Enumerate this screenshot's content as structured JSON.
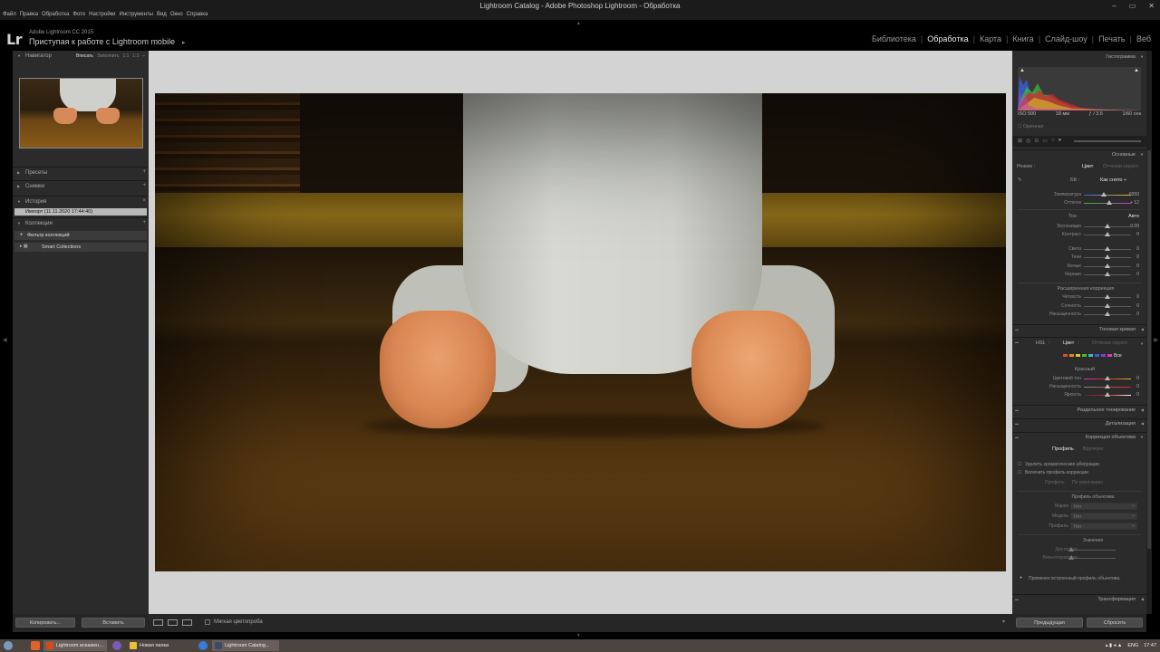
{
  "window": {
    "title": "Lightroom Catalog - Adobe Photoshop Lightroom - Обработка",
    "menu": [
      "Файл",
      "Правка",
      "Обработка",
      "Фото",
      "Настройки",
      "Инструменты",
      "Вид",
      "Окно",
      "Справка"
    ],
    "controls": [
      "–",
      "▭",
      "✕"
    ]
  },
  "identity": {
    "logo": "Lr",
    "subtitle": "Adobe Lightroom CC 2015",
    "main": "Приступая к работе с Lightroom mobile",
    "arrow": "▸"
  },
  "modules": [
    {
      "label": "Библиотека",
      "active": false
    },
    {
      "label": "Обработка",
      "active": true
    },
    {
      "label": "Карта",
      "active": false
    },
    {
      "label": "Книга",
      "active": false
    },
    {
      "label": "Слайд-шоу",
      "active": false
    },
    {
      "label": "Печать",
      "active": false
    },
    {
      "label": "Веб",
      "active": false
    }
  ],
  "left": {
    "navigator": {
      "label": "Навигатор",
      "zooms": [
        "Вписать",
        "Заполнить",
        "1:1",
        "1:3"
      ],
      "active_zoom": 0,
      "arrow": "÷"
    },
    "presets": {
      "label": "Пресеты",
      "plus": "+"
    },
    "snapshots": {
      "label": "Снимки",
      "plus": "+"
    },
    "history": {
      "label": "История",
      "close": "×",
      "item": "Импорт (11.11.2020 17:44:40)"
    },
    "collections": {
      "label": "Коллекции",
      "plus": "+",
      "filter": "Фильтр коллекций",
      "smart": "Smart Collections"
    },
    "buttons": {
      "copy": "Копировать...",
      "paste": "Вставить"
    }
  },
  "toolbar": {
    "softproof": "Мягкая цветопроба"
  },
  "right": {
    "histogram": {
      "label": "Гистограмма",
      "iso": "ISO 500",
      "focal": "18 мм",
      "aperture": "ƒ / 3.5",
      "shutter": "1/60 сек",
      "original": "Оригинал",
      "colors": {
        "red": "#d8262a",
        "green": "#35b83a",
        "blue": "#3a5ee0",
        "yellow": "#d8c22a",
        "magenta": "#c43ac4",
        "cyan": "#3ac4c4"
      }
    },
    "basic": {
      "label": "Основные",
      "treatment_label": "Режим :",
      "treatment_color": "Цвет",
      "treatment_bw": "Оттенки серого",
      "wb_label": "ББ :",
      "wb_value": "Как снято",
      "wb_arrow": "÷",
      "temp": {
        "label": "Температура",
        "value": "6050",
        "pos": 0.42
      },
      "tint": {
        "label": "Оттенок",
        "value": "+ 12",
        "pos": 0.53
      },
      "tone_label": "Тон",
      "tone_auto": "Авто",
      "exposure": {
        "label": "Экспозиция",
        "value": "0.00",
        "pos": 0.5
      },
      "contrast": {
        "label": "Контраст",
        "value": "0",
        "pos": 0.5
      },
      "highlights": {
        "label": "Света",
        "value": "0",
        "pos": 0.5
      },
      "shadows": {
        "label": "Тени",
        "value": "0",
        "pos": 0.5
      },
      "whites": {
        "label": "Белые",
        "value": "0",
        "pos": 0.5
      },
      "blacks": {
        "label": "Черные",
        "value": "0",
        "pos": 0.5
      },
      "presence_label": "Расширенная коррекция",
      "clarity": {
        "label": "Четкость",
        "value": "0",
        "pos": 0.5
      },
      "vibrance": {
        "label": "Сочность",
        "value": "0",
        "pos": 0.5
      },
      "saturation": {
        "label": "Насыщенность",
        "value": "0",
        "pos": 0.5
      }
    },
    "tonecurve": {
      "label": "Тоновая кривая"
    },
    "hsl": {
      "tab_hsl": "HSL",
      "tab_color": "Цвет",
      "tab_bw": "Оттенки серого",
      "all": "Все",
      "swatches": [
        "#d84a3a",
        "#d88a2a",
        "#d8c82a",
        "#4ab83a",
        "#3ab8b8",
        "#3a5ed8",
        "#8a3ad8",
        "#d83ab8"
      ],
      "red_label": "Красный",
      "hue": {
        "label": "Цветовой тон",
        "value": "0",
        "pos": 0.5
      },
      "sat": {
        "label": "Насыщенность",
        "value": "0",
        "pos": 0.5
      },
      "lum": {
        "label": "Яркость",
        "value": "0",
        "pos": 0.5
      }
    },
    "split": {
      "label": "Раздельное тонирование"
    },
    "detail": {
      "label": "Детализация"
    },
    "lens": {
      "label": "Коррекция объектива",
      "tab_profile": "Профиль",
      "tab_manual": "Вручную",
      "remove_ca": "Удалить хроматические аберрации",
      "enable_profile": "Включить профиль коррекции",
      "setup_label": "Профиль",
      "setup_value": "По умолчанию",
      "lens_profile_label": "Профиль объектива",
      "make_label": "Марка",
      "model_label": "Модель",
      "profile_label": "Профиль",
      "amount_label": "Значения",
      "distortion_label": "Дисторсия",
      "vignetting_label": "Виньетирование",
      "builtin_note": "Применен встроенный профиль объектива."
    },
    "transform": {
      "label": "Трансформация"
    },
    "buttons": {
      "previous": "Предыдущая",
      "reset": "Сбросить"
    }
  },
  "taskbar": {
    "items": [
      {
        "label": "Lightroom искажен...",
        "color": "#d84a1a"
      },
      {
        "label": "Новая папка",
        "color": "#e8c03a"
      },
      {
        "label": "Lightroom Catalog...",
        "color": "#3a4a6a"
      }
    ],
    "lang": "ENG",
    "time": "17:47"
  }
}
